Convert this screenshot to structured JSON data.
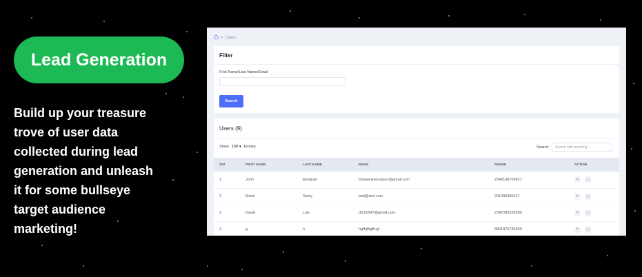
{
  "promo": {
    "badge": "Lead Generation",
    "lines": [
      "Build up your treasure",
      "trove of user data",
      "collected during lead",
      "generation and unleash",
      "it for some bullseye",
      "target audience",
      "marketing!"
    ]
  },
  "app": {
    "breadcrumb": "Users",
    "filter": {
      "title": "Filter",
      "field_label": "First Name/Last Name/Email",
      "field_value": "",
      "button": "Search"
    },
    "users": {
      "title": "Users (9)",
      "show_label": "Show",
      "page_size": "100",
      "entries_label": "Entries",
      "search_label": "Search:",
      "search_placeholder": "Search with anything...",
      "columns": [
        "S/N",
        "FIRST NAME",
        "LAST NAME",
        "EMAIL",
        "PHONE",
        "ACTION"
      ],
      "rows": [
        {
          "sn": "1",
          "first": "John",
          "last": "Elusiyan",
          "email": "toluwaninelusiyan@gmail.com",
          "phone": "2348136709821"
        },
        {
          "sn": "2",
          "first": "Mario",
          "last": "Samy",
          "email": "test@test.com",
          "phone": "201280286427"
        },
        {
          "sn": "2",
          "first": "David",
          "last": "Luis",
          "email": "dl192547@gmail.com",
          "phone": "2347080228280"
        },
        {
          "sn": "4",
          "first": "g",
          "last": "h",
          "email": "hgfhjfhgfh.gf",
          "phone": "8801876749390"
        }
      ]
    }
  },
  "colors": {
    "brand": "#1db954",
    "accent": "#4f6ef7"
  }
}
